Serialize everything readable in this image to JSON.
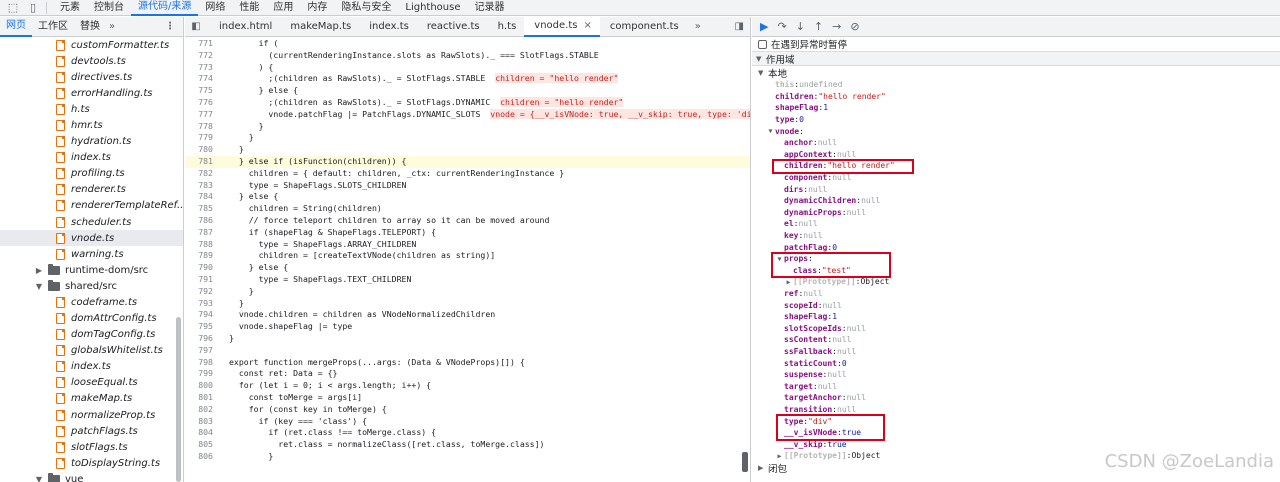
{
  "toolbar": {
    "tabs": [
      "元素",
      "控制台",
      "源代码/来源",
      "网络",
      "性能",
      "应用",
      "内存",
      "隐私与安全",
      "Lighthouse",
      "记录器"
    ],
    "active_index": 2
  },
  "sidebar": {
    "tabs": [
      "网页",
      "工作区",
      "替换"
    ],
    "more": "»",
    "menu": "⋮",
    "files_top": [
      "customFormatter.ts",
      "devtools.ts",
      "directives.ts",
      "errorHandling.ts",
      "h.ts",
      "hmr.ts",
      "hydration.ts",
      "index.ts",
      "profiling.ts",
      "renderer.ts",
      "rendererTemplateRef...",
      "scheduler.ts",
      "vnode.ts",
      "warning.ts"
    ],
    "selected_file": "vnode.ts",
    "folder_runtime_dom": "runtime-dom/src",
    "folder_shared": "shared/src",
    "files_shared": [
      "codeframe.ts",
      "domAttrConfig.ts",
      "domTagConfig.ts",
      "globalsWhitelist.ts",
      "index.ts",
      "looseEqual.ts",
      "makeMap.ts",
      "normalizeProp.ts",
      "patchFlags.ts",
      "slotFlags.ts",
      "toDisplayString.ts"
    ],
    "folder_vue": "vue"
  },
  "editor": {
    "tabs": [
      "index.html",
      "makeMap.ts",
      "index.ts",
      "reactive.ts",
      "h.ts",
      "vnode.ts",
      "component.ts"
    ],
    "active_tab": "vnode.ts",
    "more": "»",
    "lines": [
      {
        "n": "771",
        "code": "      if ("
      },
      {
        "n": "772",
        "code": "        (currentRenderingInstance.slots as RawSlots)._ === SlotFlags.STABLE"
      },
      {
        "n": "773",
        "code": "      ) {"
      },
      {
        "n": "774",
        "code": "        ;(children as RawSlots)._ = SlotFlags.STABLE",
        "inline": "children = \"hello render\""
      },
      {
        "n": "775",
        "code": "      } else {"
      },
      {
        "n": "776",
        "code": "        ;(children as RawSlots)._ = SlotFlags.DYNAMIC",
        "inline": "children = \"hello render\""
      },
      {
        "n": "777",
        "code": "        vnode.patchFlag |= PatchFlags.DYNAMIC_SLOTS",
        "inline": "vnode = {__v_isVNode: true, __v_skip: true, type: 'div', prop"
      },
      {
        "n": "778",
        "code": "      }"
      },
      {
        "n": "779",
        "code": "    }"
      },
      {
        "n": "780",
        "code": "  }"
      },
      {
        "n": "781",
        "code": "  } else if (isFunction(children)) {",
        "highlight": true
      },
      {
        "n": "782",
        "code": "    children = { default: children, _ctx: currentRenderingInstance }"
      },
      {
        "n": "783",
        "code": "    type = ShapeFlags.SLOTS_CHILDREN"
      },
      {
        "n": "784",
        "code": "  } else {"
      },
      {
        "n": "785",
        "code": "    children = String(children)"
      },
      {
        "n": "786",
        "code": "    // force teleport children to array so it can be moved around"
      },
      {
        "n": "787",
        "code": "    if (shapeFlag & ShapeFlags.TELEPORT) {"
      },
      {
        "n": "788",
        "code": "      type = ShapeFlags.ARRAY_CHILDREN"
      },
      {
        "n": "789",
        "code": "      children = [createTextVNode(children as string)]"
      },
      {
        "n": "790",
        "code": "    } else {"
      },
      {
        "n": "791",
        "code": "      type = ShapeFlags.TEXT_CHILDREN"
      },
      {
        "n": "792",
        "code": "    }"
      },
      {
        "n": "793",
        "code": "  }"
      },
      {
        "n": "794",
        "code": "  vnode.children = children as VNodeNormalizedChildren"
      },
      {
        "n": "795",
        "code": "  vnode.shapeFlag |= type"
      },
      {
        "n": "796",
        "code": "}"
      },
      {
        "n": "797",
        "code": ""
      },
      {
        "n": "798",
        "code": "export function mergeProps(...args: (Data & VNodeProps)[]) {"
      },
      {
        "n": "799",
        "code": "  const ret: Data = {}"
      },
      {
        "n": "800",
        "code": "  for (let i = 0; i < args.length; i++) {"
      },
      {
        "n": "801",
        "code": "    const toMerge = args[i]"
      },
      {
        "n": "802",
        "code": "    for (const key in toMerge) {"
      },
      {
        "n": "803",
        "code": "      if (key === 'class') {"
      },
      {
        "n": "804",
        "code": "        if (ret.class !== toMerge.class) {"
      },
      {
        "n": "805",
        "code": "          ret.class = normalizeClass([ret.class, toMerge.class])"
      },
      {
        "n": "806",
        "code": "        }"
      }
    ]
  },
  "debugger": {
    "pause_on_exceptions": "在遇到异常时暂停",
    "scope_section": "作用域",
    "local_scope": "本地",
    "closure": "闭包",
    "props": [
      {
        "indent": 0,
        "key": "this",
        "value": "undefined",
        "vtype": "null",
        "dim": true
      },
      {
        "indent": 0,
        "key": "children",
        "value": "\"hello render\"",
        "vtype": "str"
      },
      {
        "indent": 0,
        "key": "shapeFlag",
        "value": "1",
        "vtype": "num"
      },
      {
        "indent": 0,
        "key": "type",
        "value": "0",
        "vtype": "num"
      },
      {
        "indent": 0,
        "key": "vnode",
        "value": "",
        "vtype": "obj",
        "expanded": true
      },
      {
        "indent": 1,
        "key": "anchor",
        "value": "null",
        "vtype": "null"
      },
      {
        "indent": 1,
        "key": "appContext",
        "value": "null",
        "vtype": "null"
      },
      {
        "indent": 1,
        "key": "children",
        "value": "\"hello render\"",
        "vtype": "str",
        "box": "a"
      },
      {
        "indent": 1,
        "key": "component",
        "value": "null",
        "vtype": "null"
      },
      {
        "indent": 1,
        "key": "dirs",
        "value": "null",
        "vtype": "null"
      },
      {
        "indent": 1,
        "key": "dynamicChildren",
        "value": "null",
        "vtype": "null"
      },
      {
        "indent": 1,
        "key": "dynamicProps",
        "value": "null",
        "vtype": "null"
      },
      {
        "indent": 1,
        "key": "el",
        "value": "null",
        "vtype": "null"
      },
      {
        "indent": 1,
        "key": "key",
        "value": "null",
        "vtype": "null"
      },
      {
        "indent": 1,
        "key": "patchFlag",
        "value": "0",
        "vtype": "num"
      },
      {
        "indent": 1,
        "key": "props",
        "value": "",
        "vtype": "obj",
        "expanded": true,
        "box": "b"
      },
      {
        "indent": 2,
        "key": "class",
        "value": "\"test\"",
        "vtype": "str"
      },
      {
        "indent": 2,
        "key": "[[Prototype]]",
        "value": "Object",
        "vtype": "obj",
        "collapsed": true,
        "dim": true
      },
      {
        "indent": 1,
        "key": "ref",
        "value": "null",
        "vtype": "null"
      },
      {
        "indent": 1,
        "key": "scopeId",
        "value": "null",
        "vtype": "null"
      },
      {
        "indent": 1,
        "key": "shapeFlag",
        "value": "1",
        "vtype": "num"
      },
      {
        "indent": 1,
        "key": "slotScopeIds",
        "value": "null",
        "vtype": "null"
      },
      {
        "indent": 1,
        "key": "ssContent",
        "value": "null",
        "vtype": "null"
      },
      {
        "indent": 1,
        "key": "ssFallback",
        "value": "null",
        "vtype": "null"
      },
      {
        "indent": 1,
        "key": "staticCount",
        "value": "0",
        "vtype": "num"
      },
      {
        "indent": 1,
        "key": "suspense",
        "value": "null",
        "vtype": "null"
      },
      {
        "indent": 1,
        "key": "target",
        "value": "null",
        "vtype": "null"
      },
      {
        "indent": 1,
        "key": "targetAnchor",
        "value": "null",
        "vtype": "null"
      },
      {
        "indent": 1,
        "key": "transition",
        "value": "null",
        "vtype": "null"
      },
      {
        "indent": 1,
        "key": "type",
        "value": "\"div\"",
        "vtype": "str",
        "box": "c"
      },
      {
        "indent": 1,
        "key": "__v_isVNode",
        "value": "true",
        "vtype": "kw"
      },
      {
        "indent": 1,
        "key": "__v_skip",
        "value": "true",
        "vtype": "kw"
      },
      {
        "indent": 1,
        "key": "[[Prototype]]",
        "value": "Object",
        "vtype": "obj",
        "collapsed": true,
        "dim": true
      }
    ]
  },
  "watermark": "CSDN @ZoeLandia"
}
